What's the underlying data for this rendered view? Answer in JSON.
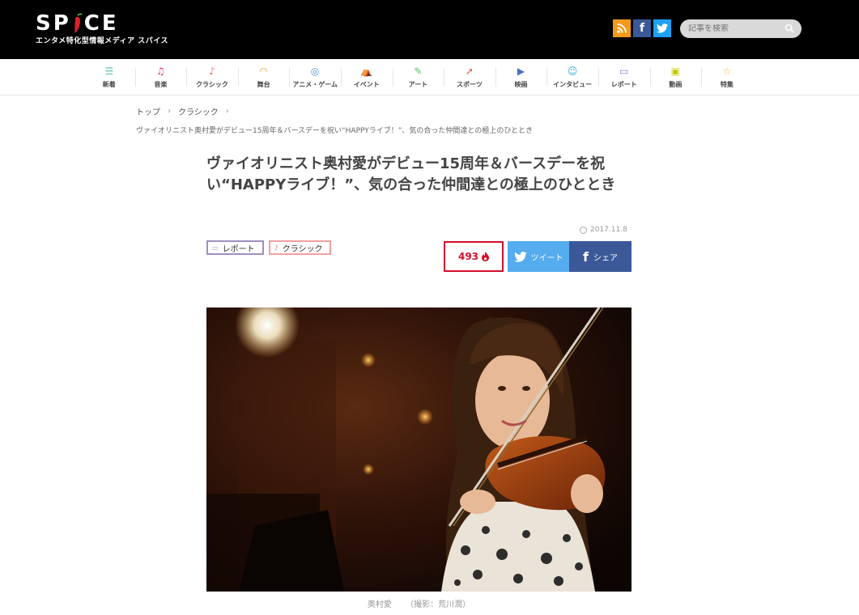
{
  "header": {
    "logo_text": "SPICE",
    "logo_subtitle": "エンタメ特化型情報メディア スパイス",
    "search_placeholder": "記事を検索",
    "social": {
      "rss": "RSS",
      "facebook": "f",
      "twitter": "t"
    }
  },
  "nav": [
    {
      "label": "新着",
      "icon": "list-icon",
      "color": "#62c1b4"
    },
    {
      "label": "音楽",
      "icon": "music-note-icon",
      "color": "#e4307a"
    },
    {
      "label": "クラシック",
      "icon": "violin-icon",
      "color": "#e86c6c"
    },
    {
      "label": "舞台",
      "icon": "stage-icon",
      "color": "#f2a23a"
    },
    {
      "label": "アニメ・ゲーム",
      "icon": "gamepad-icon",
      "color": "#4c8ed9"
    },
    {
      "label": "イベント",
      "icon": "tent-icon",
      "color": "#c58ed8"
    },
    {
      "label": "アート",
      "icon": "palette-icon",
      "color": "#54c06a"
    },
    {
      "label": "スポーツ",
      "icon": "runner-icon",
      "color": "#ee5a3a"
    },
    {
      "label": "映画",
      "icon": "camera-icon",
      "color": "#4c6fc4"
    },
    {
      "label": "インタビュー",
      "icon": "people-icon",
      "color": "#38a9d8"
    },
    {
      "label": "レポート",
      "icon": "report-icon",
      "color": "#9b7bc4"
    },
    {
      "label": "動画",
      "icon": "video-icon",
      "color": "#c8c800"
    },
    {
      "label": "特集",
      "icon": "star-icon",
      "color": "#f2c12e"
    }
  ],
  "breadcrumb": {
    "items": [
      "トップ",
      "クラシック"
    ],
    "current": "ヴァイオリニスト奥村愛がデビュー15周年＆バースデーを祝い“HAPPYライブ！”、気の合った仲間達との極上のひととき"
  },
  "article": {
    "title": "ヴァイオリニスト奥村愛がデビュー15周年＆バースデーを祝い“HAPPYライブ！”、気の合った仲間達との極上のひととき",
    "date": "2017.11.8",
    "tags": [
      {
        "label": "レポート",
        "icon": "report-icon"
      },
      {
        "label": "クラシック",
        "icon": "violin-icon"
      }
    ],
    "share": {
      "count": "493",
      "tweet_label": "ツイート",
      "share_label": "シェア"
    },
    "caption_name": "奥村愛",
    "caption_credit": "（撮影：荒川潤）"
  },
  "colors": {
    "header_bg": "#000000",
    "accent_red": "#d0102a",
    "twitter": "#55acee",
    "facebook": "#3b5998",
    "tag_report": "#9f8fc0",
    "tag_classic": "#f0a0a0"
  }
}
